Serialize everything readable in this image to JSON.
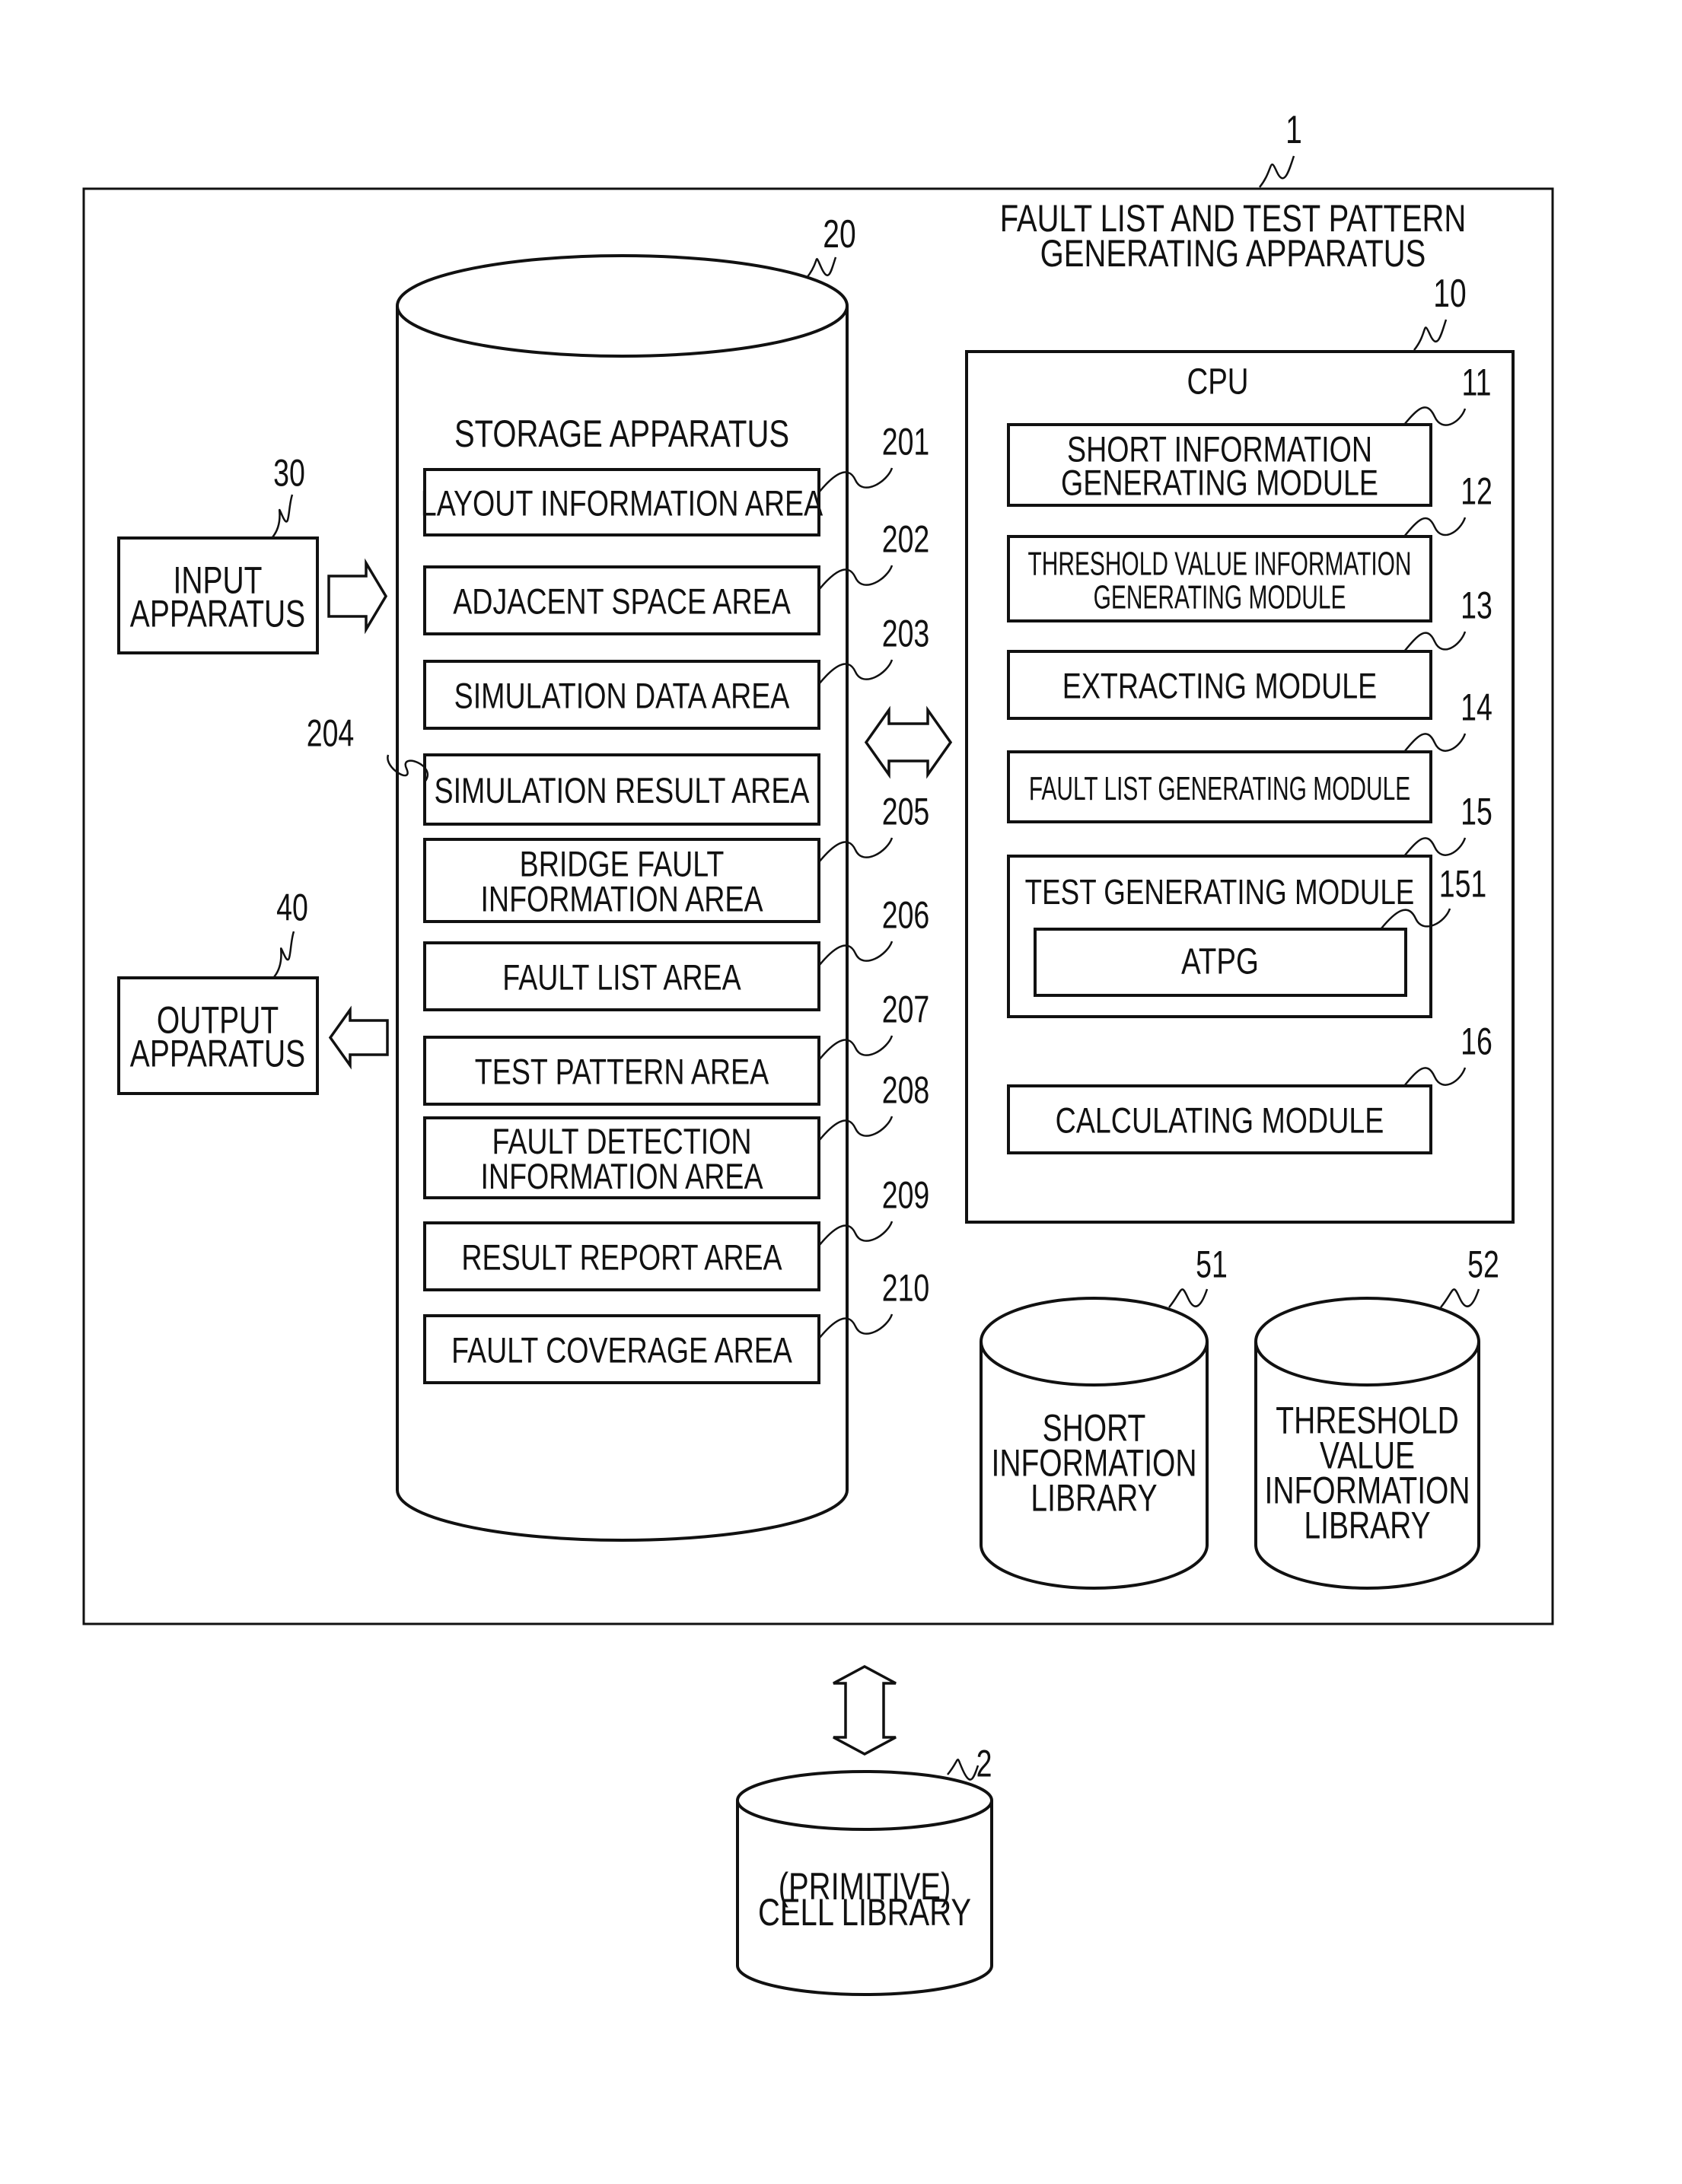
{
  "figure": {
    "apparatus_ref": "1",
    "apparatus_title_lines": [
      "FAULT LIST AND TEST PATTERN",
      "GENERATING APPARATUS"
    ]
  },
  "storage": {
    "ref": "20",
    "title": "STORAGE APPARATUS",
    "areas": [
      {
        "ref": "201",
        "lines": [
          "LAYOUT INFORMATION AREA"
        ]
      },
      {
        "ref": "202",
        "lines": [
          "ADJACENT SPACE AREA"
        ]
      },
      {
        "ref": "203",
        "lines": [
          "SIMULATION DATA AREA"
        ]
      },
      {
        "ref": "204",
        "lines": [
          "SIMULATION RESULT AREA"
        ]
      },
      {
        "ref": "205",
        "lines": [
          "BRIDGE FAULT",
          "INFORMATION AREA"
        ]
      },
      {
        "ref": "206",
        "lines": [
          "FAULT LIST AREA"
        ]
      },
      {
        "ref": "207",
        "lines": [
          "TEST PATTERN AREA"
        ]
      },
      {
        "ref": "208",
        "lines": [
          "FAULT DETECTION",
          "INFORMATION AREA"
        ]
      },
      {
        "ref": "209",
        "lines": [
          "RESULT REPORT AREA"
        ]
      },
      {
        "ref": "210",
        "lines": [
          "FAULT COVERAGE AREA"
        ]
      }
    ]
  },
  "input_device": {
    "ref": "30",
    "lines": [
      "INPUT",
      "APPARATUS"
    ]
  },
  "output_device": {
    "ref": "40",
    "lines": [
      "OUTPUT",
      "APPARATUS"
    ]
  },
  "cpu": {
    "ref": "10",
    "title": "CPU",
    "modules": [
      {
        "ref": "11",
        "lines": [
          "SHORT INFORMATION",
          "GENERATING MODULE"
        ]
      },
      {
        "ref": "12",
        "lines": [
          "THRESHOLD VALUE INFORMATION",
          "GENERATING MODULE"
        ]
      },
      {
        "ref": "13",
        "lines": [
          "EXTRACTING MODULE"
        ]
      },
      {
        "ref": "14",
        "lines": [
          "FAULT LIST GENERATING MODULE"
        ]
      },
      {
        "ref": "15",
        "lines": [
          "TEST GENERATING MODULE"
        ],
        "submodule": {
          "ref": "151",
          "label": "ATPG"
        }
      },
      {
        "ref": "16",
        "lines": [
          "CALCULATING MODULE"
        ]
      }
    ]
  },
  "libraries": [
    {
      "ref": "51",
      "lines": [
        "SHORT",
        "INFORMATION",
        "LIBRARY"
      ]
    },
    {
      "ref": "52",
      "lines": [
        "THRESHOLD",
        "VALUE",
        "INFORMATION",
        "LIBRARY"
      ]
    }
  ],
  "cell_library": {
    "ref": "2",
    "lines": [
      "(PRIMITIVE)",
      "CELL LIBRARY"
    ]
  },
  "connections": [
    {
      "from": "INPUT APPARATUS",
      "to": "STORAGE APPARATUS",
      "kind": "arrow-right"
    },
    {
      "from": "STORAGE APPARATUS",
      "to": "OUTPUT APPARATUS",
      "kind": "arrow-left"
    },
    {
      "from": "STORAGE APPARATUS",
      "to": "CPU",
      "kind": "bidirectional"
    },
    {
      "from": "FAULT LIST AND TEST PATTERN GENERATING APPARATUS",
      "to": "(PRIMITIVE) CELL LIBRARY",
      "kind": "bidirectional"
    }
  ]
}
